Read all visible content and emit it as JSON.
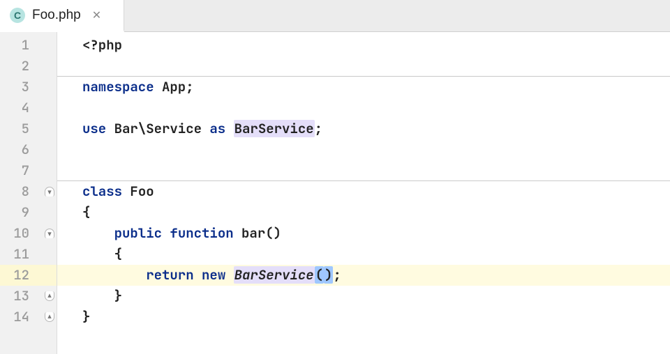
{
  "tab": {
    "icon_letter": "C",
    "filename": "Foo.php",
    "close_glyph": "✕"
  },
  "gutter": {
    "1": "1",
    "2": "2",
    "3": "3",
    "4": "4",
    "5": "5",
    "6": "6",
    "7": "7",
    "8": "8",
    "9": "9",
    "10": "10",
    "11": "11",
    "12": "12",
    "13": "13",
    "14": "14"
  },
  "code": {
    "l1_open": "<?php",
    "l3_ns_kw": "namespace",
    "l3_ns_name": " App",
    "l5_use_kw": "use",
    "l5_use_path": " Bar\\Service ",
    "l5_as_kw": "as",
    "l5_space": " ",
    "l5_alias": "BarService",
    "l8_class_kw": "class",
    "l8_class_name": " Foo",
    "l9_brace": "{",
    "l10_indent": "    ",
    "l10_vis": "public",
    "l10_sp1": " ",
    "l10_fn_kw": "function",
    "l10_fn_sig": " bar()",
    "l11_brace": "    {",
    "l12_indent": "        ",
    "l12_ret": "return",
    "l12_sp1": " ",
    "l12_new": "new",
    "l12_sp2": " ",
    "l12_cls": "BarService",
    "l12_lp": "(",
    "l12_rp": ")",
    "l12_semi": ";",
    "l13_brace": "    }",
    "l14_brace": "}"
  },
  "punct": {
    "semi": ";"
  }
}
